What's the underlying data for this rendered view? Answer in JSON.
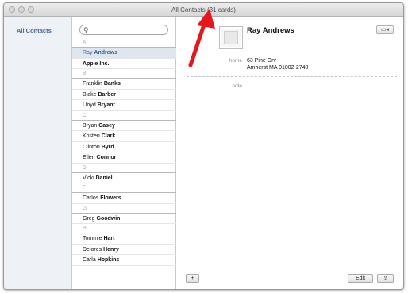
{
  "window": {
    "title": "All Contacts (31 cards)"
  },
  "groups": {
    "items": [
      {
        "label": "All Contacts"
      }
    ]
  },
  "search": {
    "placeholder": "",
    "value": ""
  },
  "icons": {
    "search": "search-icon",
    "facetime": "facetime-icon",
    "share": "share-icon",
    "add": "plus-icon"
  },
  "contacts": {
    "rows": [
      {
        "type": "letter",
        "text": "A"
      },
      {
        "type": "contact",
        "first": "Ray ",
        "last": "Andrews",
        "selected": true
      },
      {
        "type": "company",
        "first": "",
        "last": "Apple Inc."
      },
      {
        "type": "letter",
        "text": "B"
      },
      {
        "type": "contact",
        "first": "Franklin ",
        "last": "Banks"
      },
      {
        "type": "contact",
        "first": "Blake ",
        "last": "Barber"
      },
      {
        "type": "contact",
        "first": "Lloyd ",
        "last": "Bryant"
      },
      {
        "type": "letter",
        "text": "C"
      },
      {
        "type": "contact",
        "first": "Bryan ",
        "last": "Casey"
      },
      {
        "type": "contact",
        "first": "Kristen ",
        "last": "Clark"
      },
      {
        "type": "contact",
        "first": "Clinton ",
        "last": "Byrd"
      },
      {
        "type": "contact",
        "first": "Ellen ",
        "last": "Connor"
      },
      {
        "type": "letter",
        "text": "D"
      },
      {
        "type": "contact",
        "first": "Vicki ",
        "last": "Daniel"
      },
      {
        "type": "letter",
        "text": "F"
      },
      {
        "type": "contact",
        "first": "Carlos ",
        "last": "Flowers"
      },
      {
        "type": "letter",
        "text": "G"
      },
      {
        "type": "contact",
        "first": "Greg ",
        "last": "Goodwin"
      },
      {
        "type": "letter",
        "text": "H"
      },
      {
        "type": "contact",
        "first": "Tommie ",
        "last": "Hart"
      },
      {
        "type": "contact",
        "first": "Delores ",
        "last": "Henry"
      },
      {
        "type": "contact",
        "first": "Carla ",
        "last": "Hopkins"
      }
    ]
  },
  "card": {
    "name": "Ray Andrews",
    "home_label": "home",
    "address_line1": "63 Pine Grv",
    "address_line2": "Amherst MA 01002-2740",
    "note_label": "note",
    "add_label": "+",
    "edit_label": "Edit",
    "share_label": "⇪",
    "facetime_label": "▭◂"
  },
  "colors": {
    "arrow": "#e8161b",
    "selected_row": "#dfe6f0",
    "group_label": "#49679a"
  }
}
